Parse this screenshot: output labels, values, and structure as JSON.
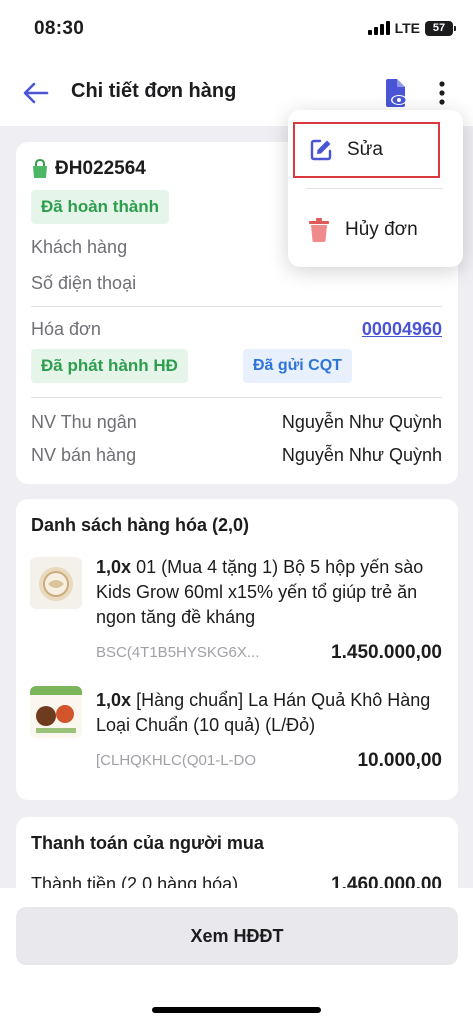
{
  "status": {
    "time": "08:30",
    "network": "LTE",
    "battery": "57"
  },
  "header": {
    "title": "Chi tiết đơn hàng"
  },
  "order": {
    "code": "ĐH022564",
    "status": "Đã hoàn thành",
    "customer_label": "Khách hàng",
    "phone_label": "Số điện thoại",
    "invoice_label": "Hóa đơn",
    "invoice_number": "00004960",
    "invoice_status": "Đã phát hành HĐ",
    "tax_status": "Đã gửi CQT",
    "cashier_label": "NV Thu ngân",
    "cashier_name": "Nguyễn Như Quỳnh",
    "seller_label": "NV bán hàng",
    "seller_name": "Nguyễn Như Quỳnh"
  },
  "items_section": {
    "title": "Danh sách hàng hóa (2,0)",
    "items": [
      {
        "qty": "1,0x",
        "name": "01 (Mua 4 tặng 1) Bộ 5 hộp yến sào Kids Grow 60ml x15% yến tổ giúp trẻ ăn ngon tăng đề kháng",
        "sku": "BSC(4T1B5HYSKG6X...",
        "price": "1.450.000,00"
      },
      {
        "qty": "1,0x",
        "name": "[Hàng chuẩn] La Hán Quả Khô Hàng Loại Chuẩn (10 quả) (L/Đỏ)",
        "sku": "[CLHQKHLC(Q01-L-DO",
        "price": "10.000,00"
      }
    ]
  },
  "payment": {
    "title": "Thanh toán của người mua",
    "total_label": "Thành tiền (2,0 hàng hóa)",
    "total_value": "1.460.000,00"
  },
  "bottom": {
    "button_label": "Xem HĐĐT"
  },
  "menu": {
    "edit_label": "Sửa",
    "cancel_label": "Hủy đơn"
  },
  "colors": {
    "accent": "#4a55d6",
    "success": "#2e9e4e",
    "danger": "#e05a5a",
    "highlight_border": "#d9393c"
  }
}
